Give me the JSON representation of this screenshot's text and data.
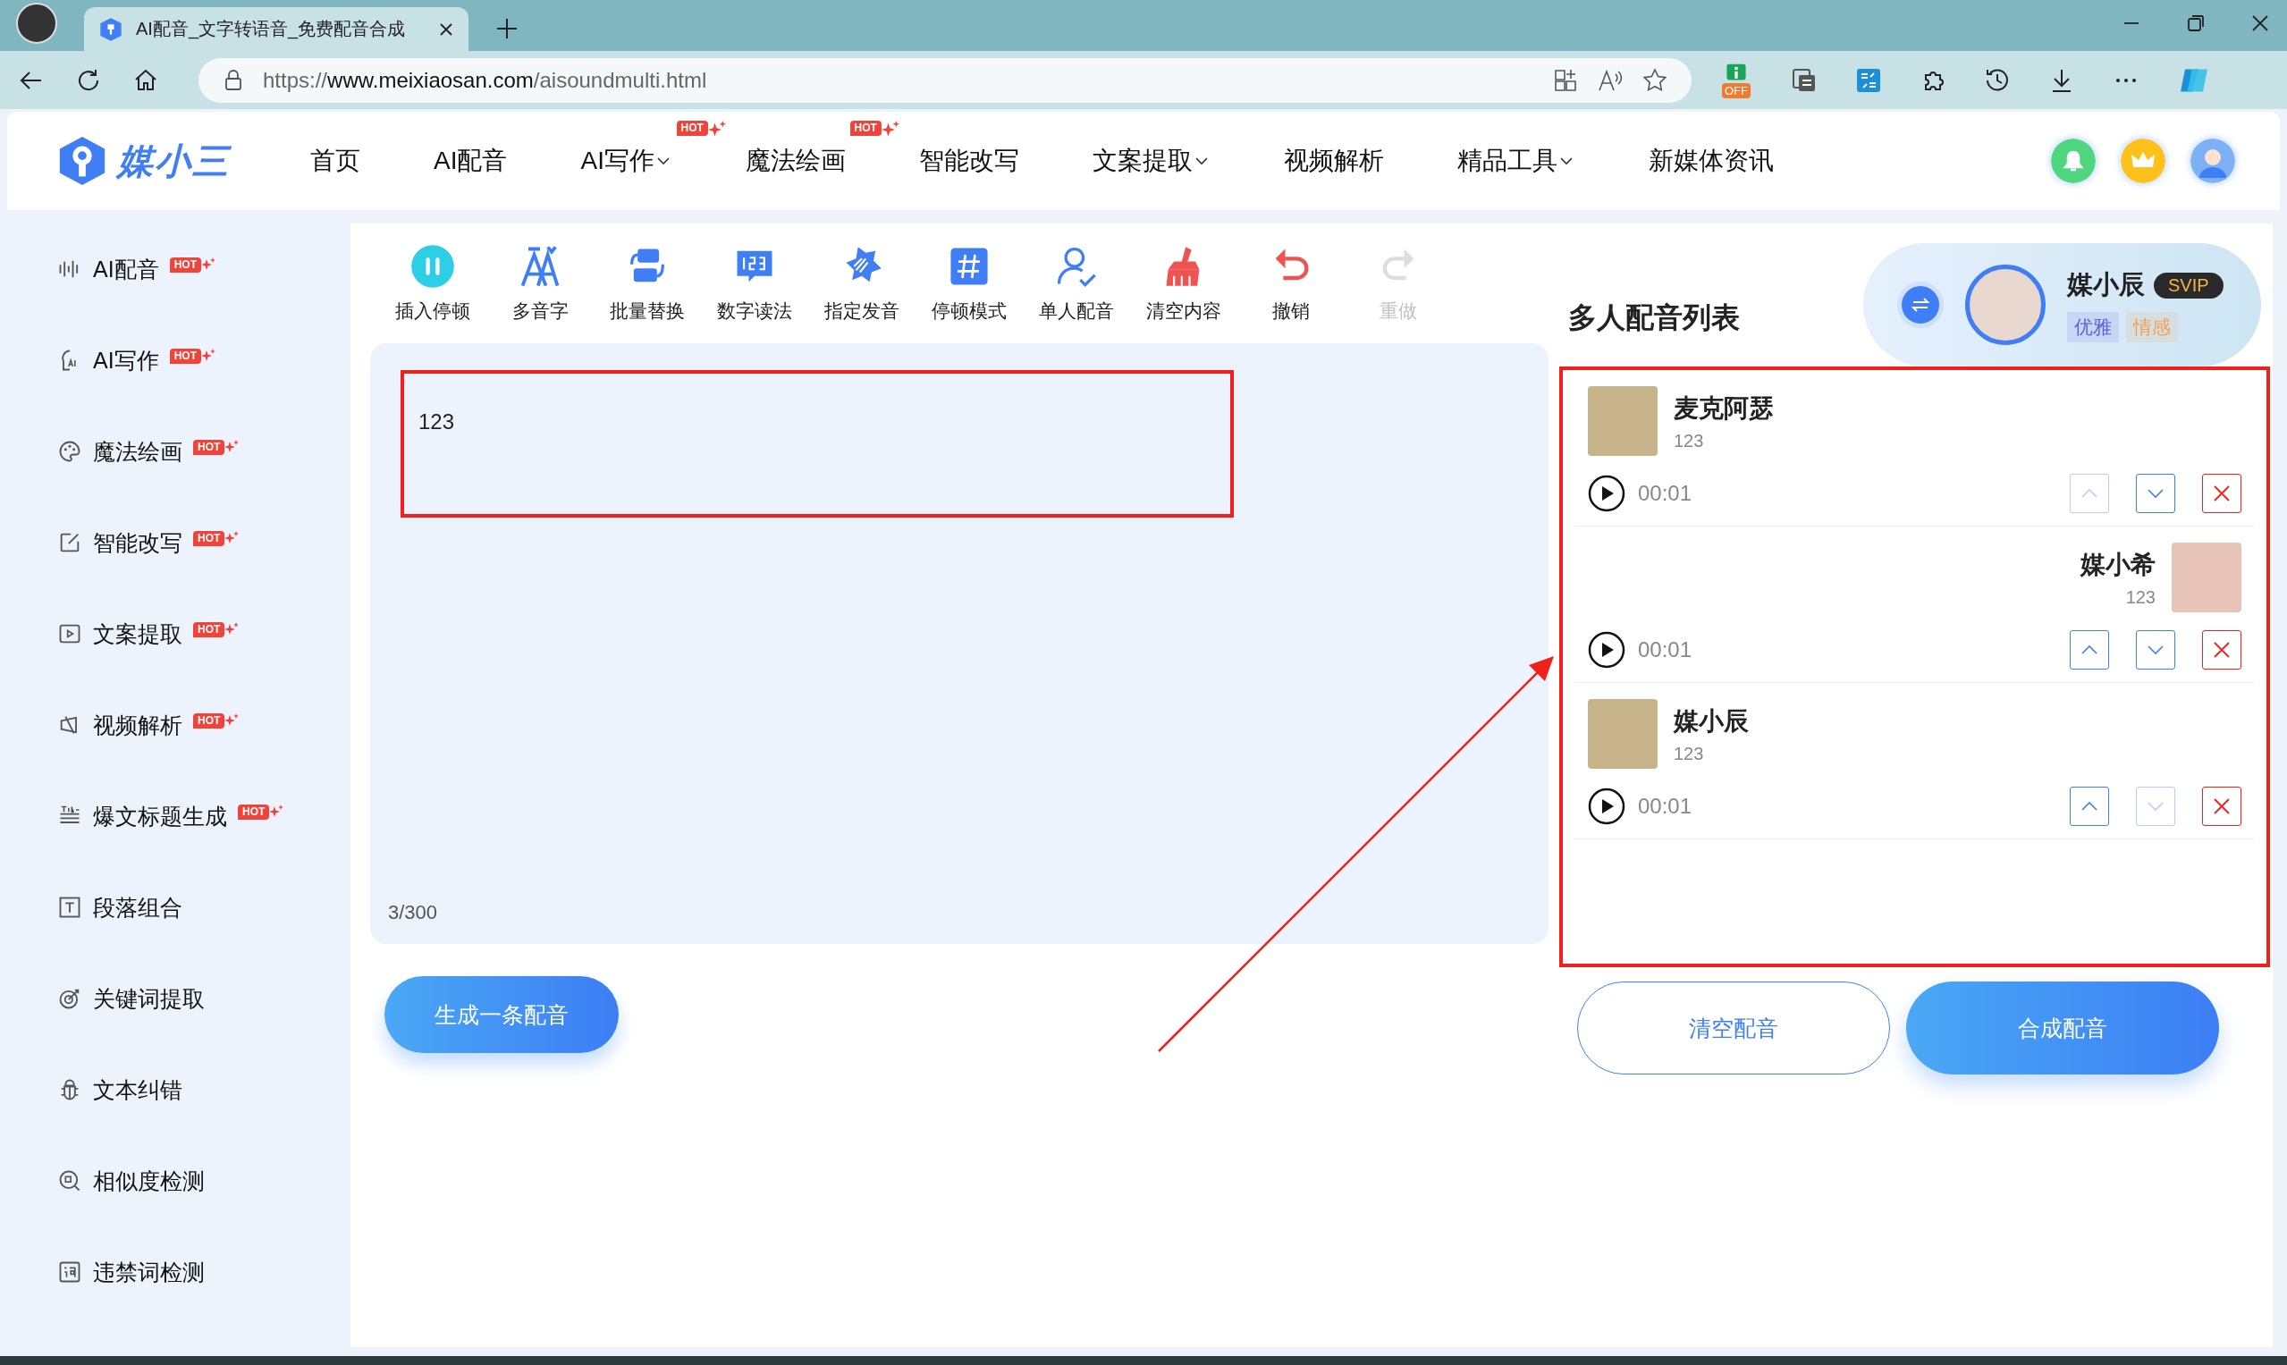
{
  "browser": {
    "tab_title": "AI配音_文字转语音_免费配音合成",
    "url_scheme": "https://",
    "url_host": "www.meixiaosan.com",
    "url_path": "/aisoundmulti.html",
    "extension_badge": "OFF"
  },
  "header": {
    "logo_text": "媒小三",
    "nav": [
      {
        "label": "首页",
        "dropdown": false
      },
      {
        "label": "AI配音",
        "dropdown": false
      },
      {
        "label": "AI写作",
        "dropdown": true,
        "badge": "HOT"
      },
      {
        "label": "魔法绘画",
        "dropdown": false,
        "badge": "HOT"
      },
      {
        "label": "智能改写",
        "dropdown": false
      },
      {
        "label": "文案提取",
        "dropdown": true
      },
      {
        "label": "视频解析",
        "dropdown": false
      },
      {
        "label": "精品工具",
        "dropdown": true
      },
      {
        "label": "新媒体资讯",
        "dropdown": false
      }
    ]
  },
  "sidebar": {
    "items": [
      {
        "label": "AI配音",
        "badge": "HOT"
      },
      {
        "label": "AI写作",
        "badge": "HOT"
      },
      {
        "label": "魔法绘画",
        "badge": "HOT"
      },
      {
        "label": "智能改写",
        "badge": "HOT"
      },
      {
        "label": "文案提取",
        "badge": "HOT"
      },
      {
        "label": "视频解析",
        "badge": "HOT"
      },
      {
        "label": "爆文标题生成",
        "badge": "HOT"
      },
      {
        "label": "段落组合"
      },
      {
        "label": "关键词提取"
      },
      {
        "label": "文本纠错"
      },
      {
        "label": "相似度检测"
      },
      {
        "label": "违禁词检测"
      }
    ]
  },
  "toolbar": [
    {
      "label": "插入停顿",
      "disabled": false
    },
    {
      "label": "多音字",
      "disabled": false
    },
    {
      "label": "批量替换",
      "disabled": false
    },
    {
      "label": "数字读法",
      "disabled": false
    },
    {
      "label": "指定发音",
      "disabled": false
    },
    {
      "label": "停顿模式",
      "disabled": false
    },
    {
      "label": "单人配音",
      "disabled": false
    },
    {
      "label": "清空内容",
      "disabled": false
    },
    {
      "label": "撤销",
      "disabled": false
    },
    {
      "label": "重做",
      "disabled": true
    }
  ],
  "editor": {
    "value": "123",
    "counter": "3/300"
  },
  "generate_button": "生成一条配音",
  "voice_list": {
    "title": "多人配音列表",
    "current_voice": {
      "name": "媒小辰",
      "badge": "SVIP",
      "tags": [
        {
          "label": "优雅",
          "color": "#5b5fe0"
        },
        {
          "label": "情感",
          "color": "#f0a050"
        }
      ]
    },
    "items": [
      {
        "name": "麦克阿瑟",
        "text": "123",
        "time": "00:01",
        "kind": "left",
        "up_disabled": true,
        "down_disabled": false
      },
      {
        "name": "媒小希",
        "text": "123",
        "time": "00:01",
        "kind": "right",
        "up_disabled": false,
        "down_disabled": false
      },
      {
        "name": "媒小辰",
        "text": "123",
        "time": "00:01",
        "kind": "left",
        "up_disabled": false,
        "down_disabled": true
      }
    ]
  },
  "buttons": [
    {
      "label": "清空配音",
      "kind": "outline"
    },
    {
      "label": "合成配音",
      "kind": "primary"
    }
  ]
}
